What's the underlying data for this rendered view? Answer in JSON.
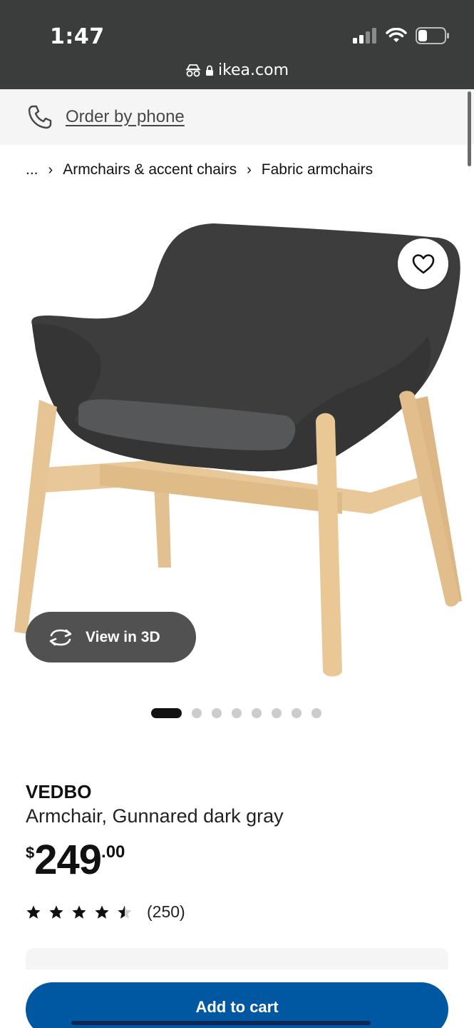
{
  "status_bar": {
    "time": "1:47",
    "url": "ikea.com"
  },
  "order_by_phone": {
    "label": "Order by phone"
  },
  "breadcrumb": [
    "...",
    "Armchairs & accent chairs",
    "Fabric armchairs"
  ],
  "view_3d": {
    "label": "View in 3D"
  },
  "carousel": {
    "total": 8,
    "active": 1
  },
  "product": {
    "name": "VEDBO",
    "description": "Armchair, Gunnared dark gray",
    "price": {
      "currency": "$",
      "integer": "249",
      "decimal": ".00"
    },
    "rating": {
      "stars": 4.5,
      "count": "(250)"
    }
  },
  "add_to_cart": {
    "label": "Add to cart"
  },
  "colors": {
    "status_bar": "#3b3c3c",
    "cart_button": "#0058a3"
  }
}
